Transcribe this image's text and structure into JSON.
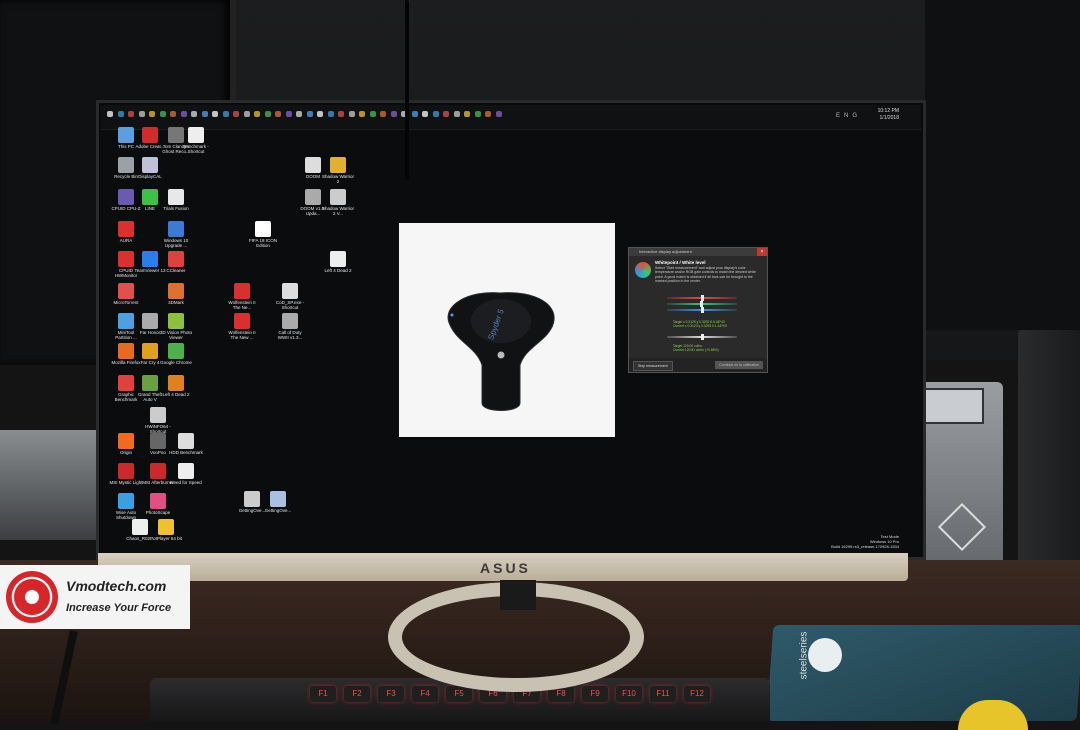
{
  "taskbar": {
    "clock_time": "10:12 PM",
    "clock_date": "1/1/2018",
    "language": "ENG"
  },
  "desktop_icons": [
    {
      "label": "This PC",
      "color": "#5aa0e0"
    },
    {
      "label": "Adobe Creat...",
      "color": "#d22b2b"
    },
    {
      "label": "Tom Clancy's Ghost Reco...",
      "color": "#777777"
    },
    {
      "label": "Benchmark - Shortcut",
      "color": "#eeeeee"
    },
    {
      "label": "Recycle Bin",
      "color": "#9aa2a8"
    },
    {
      "label": "DisplayCAL",
      "color": "#c0c0d8"
    },
    {
      "label": "CPUID CPU-Z",
      "color": "#6a5ab0"
    },
    {
      "label": "LINE",
      "color": "#3cc14a"
    },
    {
      "label": "Trials Fusion",
      "color": "#e8e8e8"
    },
    {
      "label": "AURA",
      "color": "#d93030"
    },
    {
      "label": "Windows 10 Upgrade ...",
      "color": "#3a7bd5"
    },
    {
      "label": "CPUID HWMonitor",
      "color": "#d93030"
    },
    {
      "label": "TeamViewer 13",
      "color": "#2b7de9"
    },
    {
      "label": "CCleaner",
      "color": "#e04040"
    },
    {
      "label": "MicroTorrent",
      "color": "#e05050"
    },
    {
      "label": "3DMark",
      "color": "#e07030"
    },
    {
      "label": "MiniTool Partition ...",
      "color": "#4fa0e0"
    },
    {
      "label": "Far Honor",
      "color": "#aaaaaa"
    },
    {
      "label": "3D Vision Photo Viewer",
      "color": "#8fbf3f"
    },
    {
      "label": "Mozilla Firefox",
      "color": "#e66a1f"
    },
    {
      "label": "Far Cry 4",
      "color": "#e0a020"
    },
    {
      "label": "Google Chrome",
      "color": "#4caf50"
    },
    {
      "label": "Graphic Benchmark",
      "color": "#e04040"
    },
    {
      "label": "Grand Theft Auto V",
      "color": "#6aa040"
    },
    {
      "label": "Left 4 Dead 2",
      "color": "#e08020"
    },
    {
      "label": "HWiNFO64 - Shortcut",
      "color": "#cccccc"
    },
    {
      "label": "Origin",
      "color": "#f06a20"
    },
    {
      "label": "VooPoo",
      "color": "#666666"
    },
    {
      "label": "HDD Benchmark",
      "color": "#dddddd"
    },
    {
      "label": "MSI Mystic Light",
      "color": "#cc2a2a"
    },
    {
      "label": "MSI Afterburner",
      "color": "#cc2a2a"
    },
    {
      "label": "Need for Speed",
      "color": "#eeeeee"
    },
    {
      "label": "Wise Auto Shutdown",
      "color": "#3aa0e0"
    },
    {
      "label": "PhotoScape",
      "color": "#e05080"
    },
    {
      "label": "Chaos_R02...",
      "color": "#eeeeee"
    },
    {
      "label": "PotPlayer 64 bit",
      "color": "#f0c030"
    },
    {
      "label": "DOOM",
      "color": "#dddddd"
    },
    {
      "label": "Shadow Warrior 2",
      "color": "#e0b030"
    },
    {
      "label": "DOOM v1.0-Upda...",
      "color": "#aaaaaa"
    },
    {
      "label": "Shadow Warrior 2 V...",
      "color": "#cccccc"
    },
    {
      "label": "FIFA 18 ICON Edition",
      "color": "#ffffff"
    },
    {
      "label": "Left 4 Dead 2",
      "color": "#eeeeee"
    },
    {
      "label": "Wolfenstein II The Ne...",
      "color": "#d83030"
    },
    {
      "label": "CoD_SP.exe - Shortcut",
      "color": "#dddddd"
    },
    {
      "label": "Wolfenstein II The New ...",
      "color": "#d83030"
    },
    {
      "label": "Call of Duty WWII v1.3...",
      "color": "#aaaaaa"
    },
    {
      "label": "GettingOve...",
      "color": "#cccccc"
    },
    {
      "label": "GettingOve...",
      "color": "#aac0e0"
    }
  ],
  "calibration_dialog": {
    "title": "Interactive display adjustment",
    "heading": "Whitepoint / White level",
    "description": "Select \"Start measurement\" and adjust your display's color temperature and/or RGB gain controls to match the desired white point. A good match is obtained if all bars can be brought to the marked position in the center.",
    "rgb_target": "Target x 0.3129 y 0.3292 6.6 ΔE*00",
    "rgb_current": "Current x 0.3123 y 0.3293 0.1 ΔE*00",
    "lum_target": "Target 120.00 cd/m²",
    "lum_current": "Current 120.81 cd/m² (+0.68%)",
    "stop_label": "Stop measurement",
    "continue_label": "Continue on to calibration",
    "slider_colors": [
      "#e74c3c",
      "#2ecc71",
      "#3498db",
      "#dddddd"
    ],
    "slider_positions": [
      0.5,
      0.49,
      0.5,
      0.51
    ]
  },
  "windows_info": {
    "mode": "Test Mode",
    "edition": "Windows 10 Pro",
    "build": "Build 16299.rs3_release.170928-1534"
  },
  "monitor": {
    "brand": "ASUS"
  },
  "probe": {
    "label": "Spyder 5"
  },
  "mousepad": {
    "brand": "steelseries"
  },
  "keyboard": {
    "keys": [
      "F1",
      "F2",
      "F3",
      "F4",
      "F5",
      "F6",
      "F7",
      "F8",
      "F9",
      "F10",
      "F11",
      "F12"
    ]
  },
  "watermark": {
    "site": "Vmodtech.com",
    "tagline": "Increase Your Force"
  }
}
